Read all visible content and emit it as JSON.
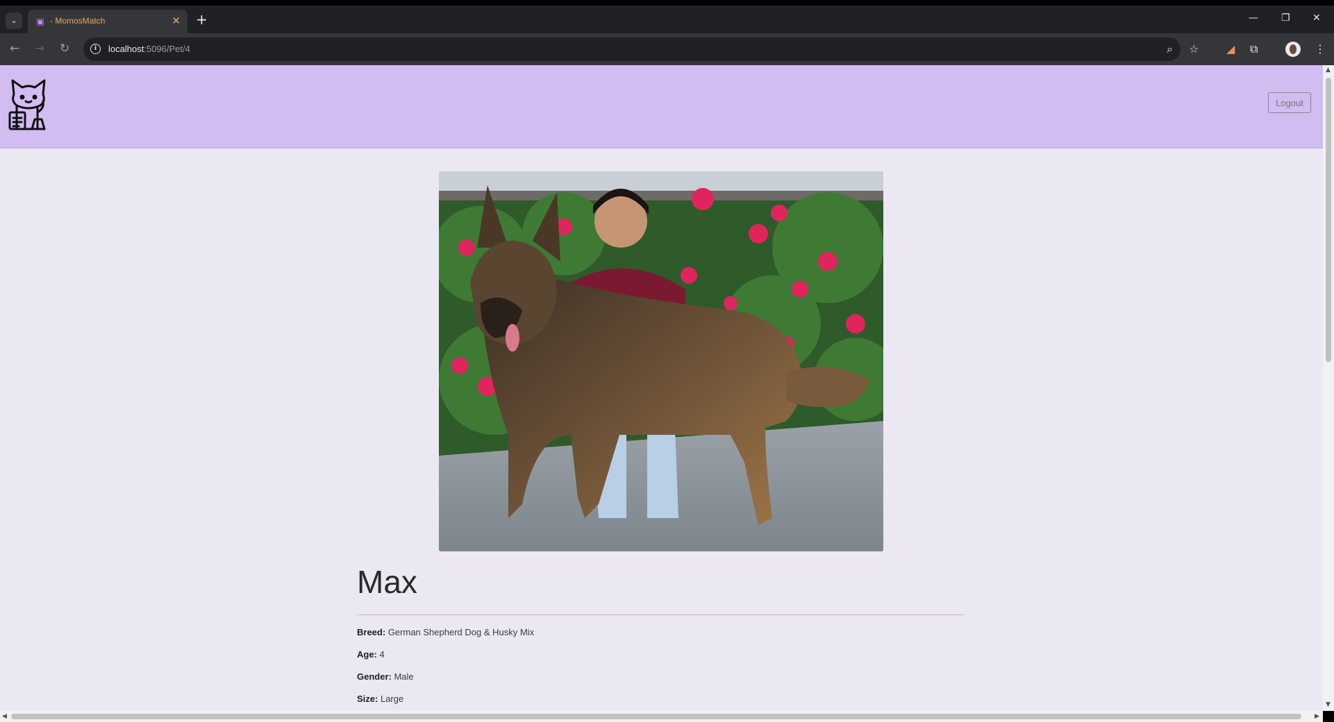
{
  "browser": {
    "tab_title": " - MomosMatch",
    "url_host": "localhost",
    "url_path": ":5096/Pet/4"
  },
  "header": {
    "logout_label": "Logout"
  },
  "pet": {
    "name": "Max",
    "details": [
      {
        "label": "Breed:",
        "value": "German Shepherd Dog & Husky Mix"
      },
      {
        "label": "Age:",
        "value": "4"
      },
      {
        "label": "Gender:",
        "value": "Male"
      },
      {
        "label": "Size:",
        "value": "Large"
      }
    ]
  },
  "icons": [
    "tab-list-icon",
    "favicon-icon",
    "close-icon",
    "new-tab-icon",
    "minimize-icon",
    "restore-icon",
    "window-close-icon",
    "back-icon",
    "forward-icon",
    "reload-icon",
    "site-info-icon",
    "zoom-icon",
    "bookmark-star-icon",
    "extension-icon",
    "puzzle-icon",
    "profile-avatar-icon",
    "more-menu-icon",
    "cat-logo-icon"
  ],
  "colors": {
    "header_bg": "#d2bcf2",
    "page_bg": "#ece8f3"
  }
}
